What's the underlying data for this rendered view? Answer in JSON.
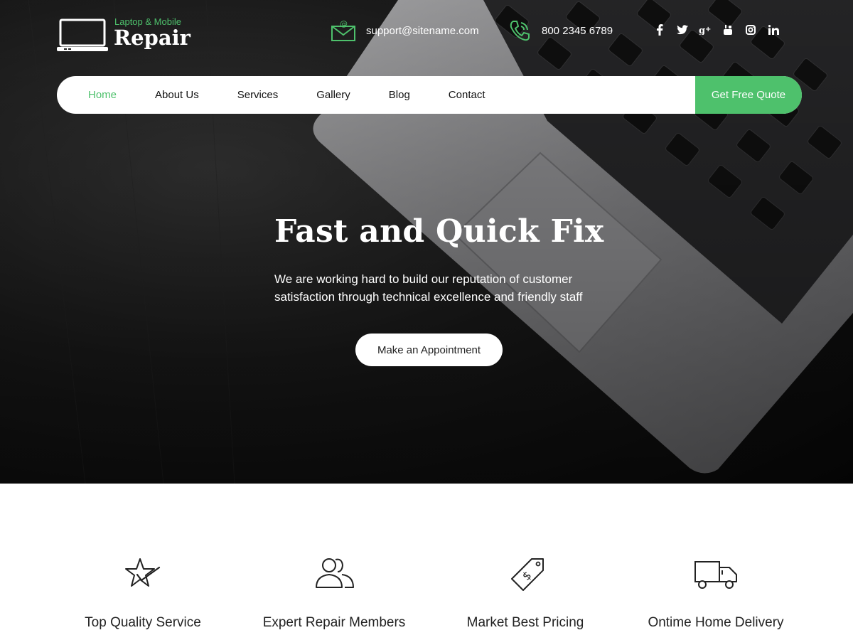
{
  "brand": {
    "tagline": "Laptop & Mobile",
    "name": "Repair",
    "accent": "#4ec16c"
  },
  "contact": {
    "email": "support@sitename.com",
    "phone": "800 2345 6789"
  },
  "socials": [
    {
      "name": "facebook-icon",
      "glyph": "f"
    },
    {
      "name": "twitter-icon",
      "glyph": "t"
    },
    {
      "name": "google-plus-icon",
      "glyph": "g+"
    },
    {
      "name": "youtube-icon",
      "glyph": "yt"
    },
    {
      "name": "instagram-icon",
      "glyph": "ig"
    },
    {
      "name": "linkedin-icon",
      "glyph": "in"
    }
  ],
  "nav": {
    "items": [
      {
        "label": "Home",
        "active": true
      },
      {
        "label": "About Us"
      },
      {
        "label": "Services"
      },
      {
        "label": "Gallery"
      },
      {
        "label": "Blog"
      },
      {
        "label": "Contact"
      }
    ],
    "quote_label": "Get Free Quote"
  },
  "hero": {
    "title": "Fast and Quick Fix",
    "text": "We are working hard to build our reputation of customer satisfaction through technical excellence and friendly staff",
    "cta_label": "Make an Appointment"
  },
  "features": [
    {
      "icon": "star-check-icon",
      "title": "Top Quality Service"
    },
    {
      "icon": "team-icon",
      "title": "Expert Repair Members"
    },
    {
      "icon": "price-tag-icon",
      "title": "Market Best Pricing"
    },
    {
      "icon": "delivery-truck-icon",
      "title": "Ontime Home Delivery"
    }
  ]
}
